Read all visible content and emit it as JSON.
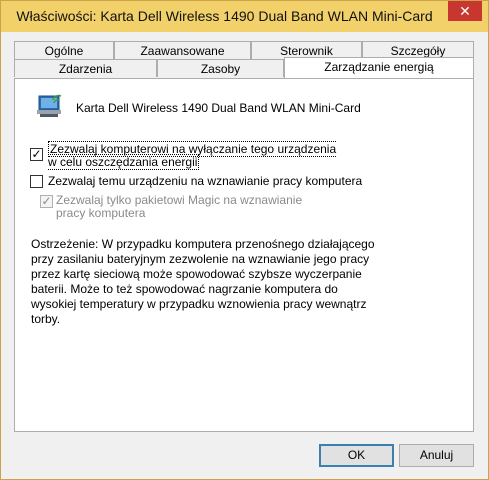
{
  "window": {
    "title": "Właściwości: Karta Dell Wireless 1490 Dual Band WLAN Mini-Card",
    "close_glyph": "✕"
  },
  "tabs": {
    "row1": [
      "Ogólne",
      "Zaawansowane",
      "Sterownik",
      "Szczegóły"
    ],
    "row2": [
      "Zdarzenia",
      "Zasoby",
      "Zarządzanie energią"
    ],
    "active": "Zarządzanie energią"
  },
  "device": {
    "name": "Karta Dell Wireless 1490 Dual Band WLAN Mini-Card",
    "icon": "network-adapter-icon"
  },
  "options": [
    {
      "label": "Zezwalaj komputerowi na wyłączanie tego urządzenia w celu oszczędzania energii",
      "checked": true,
      "enabled": true
    },
    {
      "label": "Zezwalaj temu urządzeniu na wznawianie pracy komputera",
      "checked": false,
      "enabled": true
    },
    {
      "label": "Zezwalaj tylko pakietowi Magic na wznawianie pracy komputera",
      "checked": true,
      "enabled": false
    }
  ],
  "warning": "Ostrzeżenie: W przypadku komputera przenośnego działającego przy zasilaniu bateryjnym zezwolenie na wznawianie jego pracy przez kartę sieciową może spowodować szybsze wyczerpanie baterii. Może to też spowodować nagrzanie komputera do wysokiej temperatury w przypadku wznowienia pracy wewnątrz torby.",
  "buttons": {
    "ok": "OK",
    "cancel": "Anuluj"
  }
}
